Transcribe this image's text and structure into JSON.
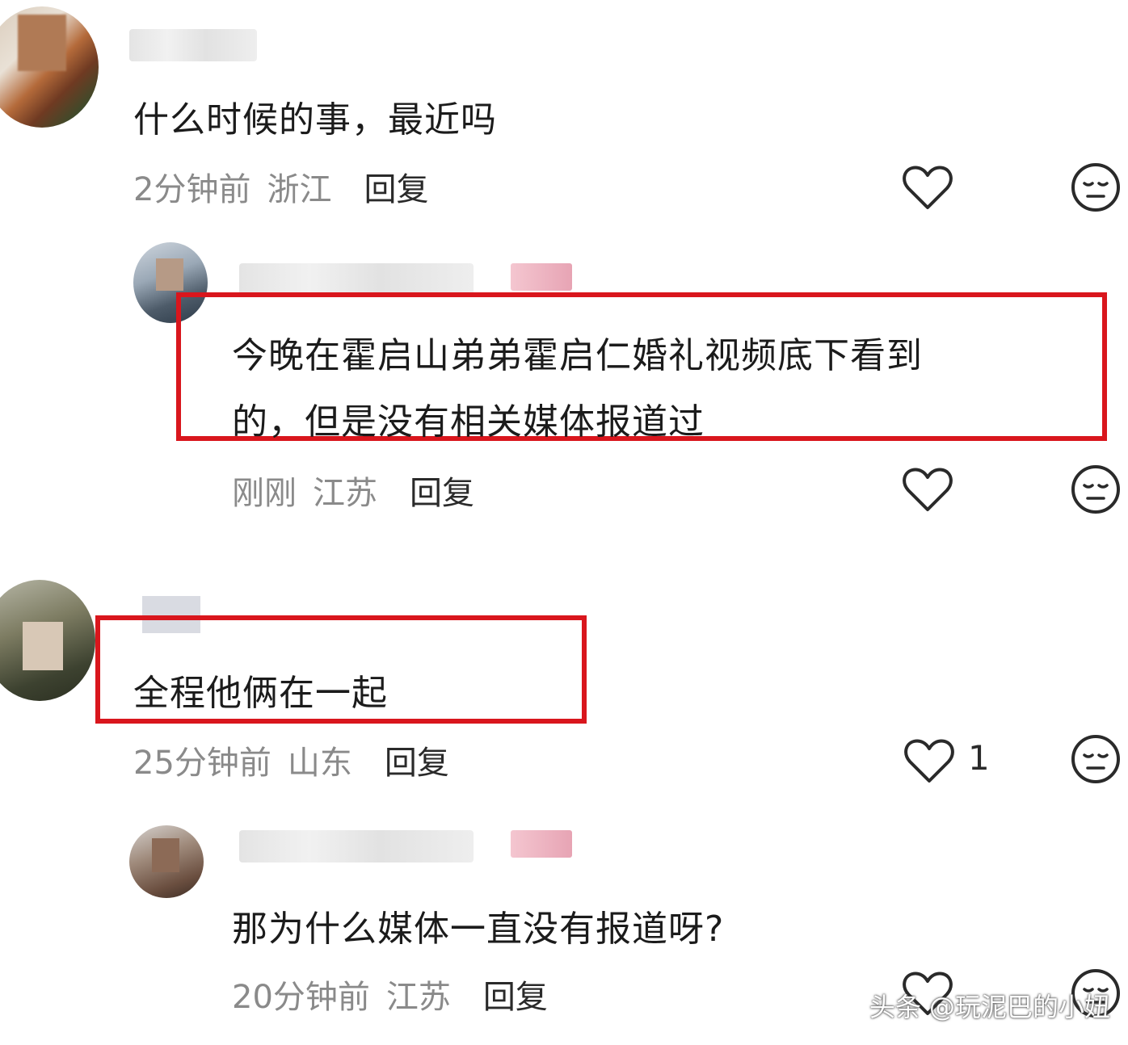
{
  "comments": [
    {
      "text": "什么时候的事，最近吗",
      "time": "2分钟前",
      "location": "浙江",
      "reply": "回复",
      "likes": ""
    },
    {
      "text_line1": "今晚在霍启山弟弟霍启仁婚礼视频底下看到",
      "text_line2": "的，但是没有相关媒体报道过",
      "time": "刚刚",
      "location": "江苏",
      "reply": "回复",
      "likes": ""
    },
    {
      "text": "全程他俩在一起",
      "time": "25分钟前",
      "location": "山东",
      "reply": "回复",
      "likes": "1"
    },
    {
      "text": "那为什么媒体一直没有报道呀?",
      "time": "20分钟前",
      "location": "江苏",
      "reply": "回复",
      "likes": ""
    }
  ],
  "icons": {
    "like": "heart-icon",
    "dislike": "neutral-face-icon"
  },
  "colors": {
    "highlight_box": "#d9161d",
    "meta_text": "#8a8a8a"
  },
  "watermark": "头条 @玩泥巴的小妞"
}
